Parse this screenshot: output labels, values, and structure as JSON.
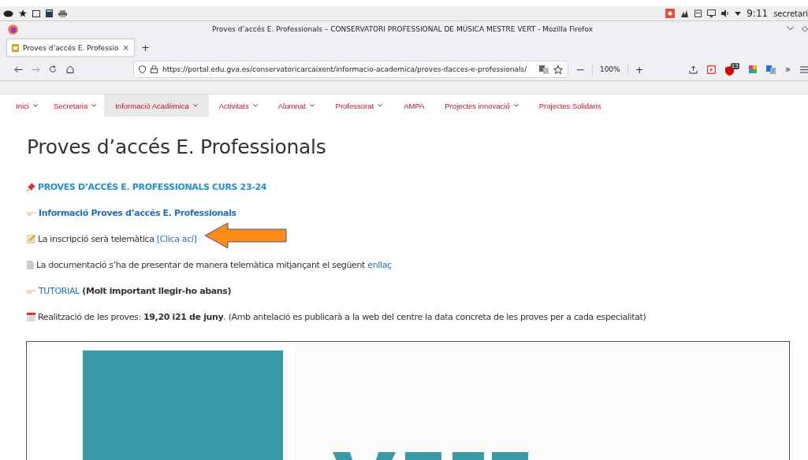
{
  "system_bar": {
    "clock": "9:11",
    "user": "secretari"
  },
  "window": {
    "title": "Proves d’accés E. Professionals – CONSERVATORI PROFESSIONAL DE MÚSICA MESTRE VERT - Mozilla Firefox"
  },
  "tabs": [
    {
      "label": "Proves d’accés E. Professio",
      "selected": true,
      "close": "×"
    }
  ],
  "new_tab": "+",
  "address_bar": {
    "url": "https://portal.edu.gva.es/conservatoricarcaixent/informacio-academica/proves-dacces-e-professionals/",
    "zoom_out": "−",
    "zoom": "100%",
    "zoom_in": "+"
  },
  "toolbar": {
    "extension_badge": "13",
    "overflow": "»"
  },
  "site_menu": [
    {
      "label": "Inici",
      "selected": false,
      "expandable": true
    },
    {
      "label": "Secretaria",
      "selected": false,
      "expandable": true
    },
    {
      "label": "Informació Acadèmica",
      "selected": true,
      "expandable": true
    },
    {
      "label": "Activitats",
      "selected": false,
      "expandable": true
    },
    {
      "label": "Alumnat",
      "selected": false,
      "expandable": true
    },
    {
      "label": "Professorat",
      "selected": false,
      "expandable": true
    },
    {
      "label": "AMPA",
      "selected": false,
      "expandable": false
    },
    {
      "label": "Projectes innovació",
      "selected": false,
      "expandable": true
    },
    {
      "label": "Projectes Solidaris",
      "selected": false,
      "expandable": false
    }
  ],
  "page": {
    "heading": "Proves d’accés E. Professionals",
    "items": [
      {
        "kind": "pin",
        "segments": [
          {
            "kind": "link_bold",
            "text": "PROVES D’ACCÉS E. PROFESSIONALS CURS 23-24"
          }
        ]
      },
      {
        "kind": "hand",
        "segments": [
          {
            "kind": "link_bold",
            "text": "Informació Proves d’accés E. Professionals"
          }
        ]
      },
      {
        "kind": "memo",
        "segments": [
          {
            "kind": "text",
            "text": "La inscripció serà telemàtica "
          },
          {
            "kind": "link",
            "text": "[Clica ací]"
          }
        ]
      },
      {
        "kind": "document",
        "segments": [
          {
            "kind": "text",
            "text": "La documentació s’ha de presentar de manera telemàtica mitjançant el següent "
          },
          {
            "kind": "link",
            "text": "enllaç"
          }
        ]
      },
      {
        "kind": "hand",
        "segments": [
          {
            "kind": "link",
            "text": "TUTORIAL"
          },
          {
            "kind": "bold",
            "text": " (Molt important llegir-ho abans)"
          }
        ]
      },
      {
        "kind": "calendar",
        "segments": [
          {
            "kind": "text",
            "text": "Realització de les proves: **19,20 i21 de juny**. (Amb antelació es publicarà a la web del centre la data concreta de les proves per a cada especialitat)"
          }
        ]
      }
    ]
  }
}
